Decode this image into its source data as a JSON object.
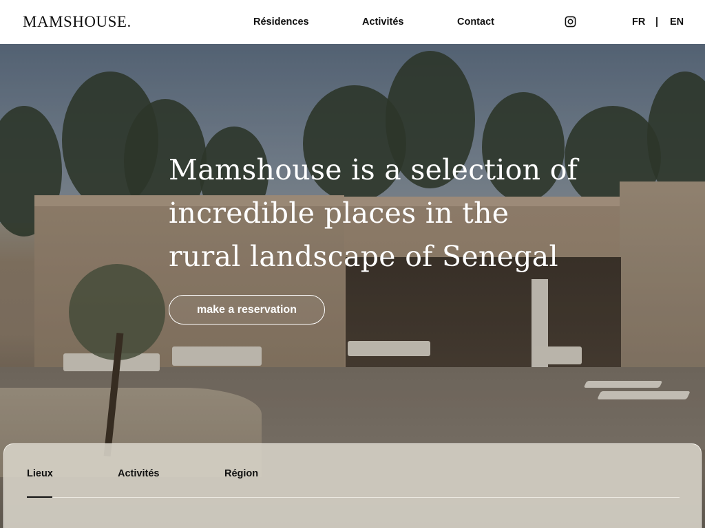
{
  "header": {
    "logo": "MAMSHOUSE.",
    "nav": [
      {
        "label": "Résidences"
      },
      {
        "label": "Activités"
      },
      {
        "label": "Contact"
      }
    ],
    "social_icon": "instagram-icon",
    "languages": {
      "fr": "FR",
      "separator": "|",
      "en": "EN"
    }
  },
  "hero": {
    "headline": "Mamshouse is a selection of incredible places in the rural landscape of Senegal",
    "cta_label": "make a reservation"
  },
  "panel": {
    "tabs": [
      {
        "label": "Lieux",
        "active": true
      },
      {
        "label": "Activités",
        "active": false
      },
      {
        "label": "Région",
        "active": false
      }
    ]
  },
  "colors": {
    "header_bg": "#ffffff",
    "text_dark": "#111111",
    "hero_text": "#ffffff",
    "panel_bg": "#d6d2c6"
  }
}
